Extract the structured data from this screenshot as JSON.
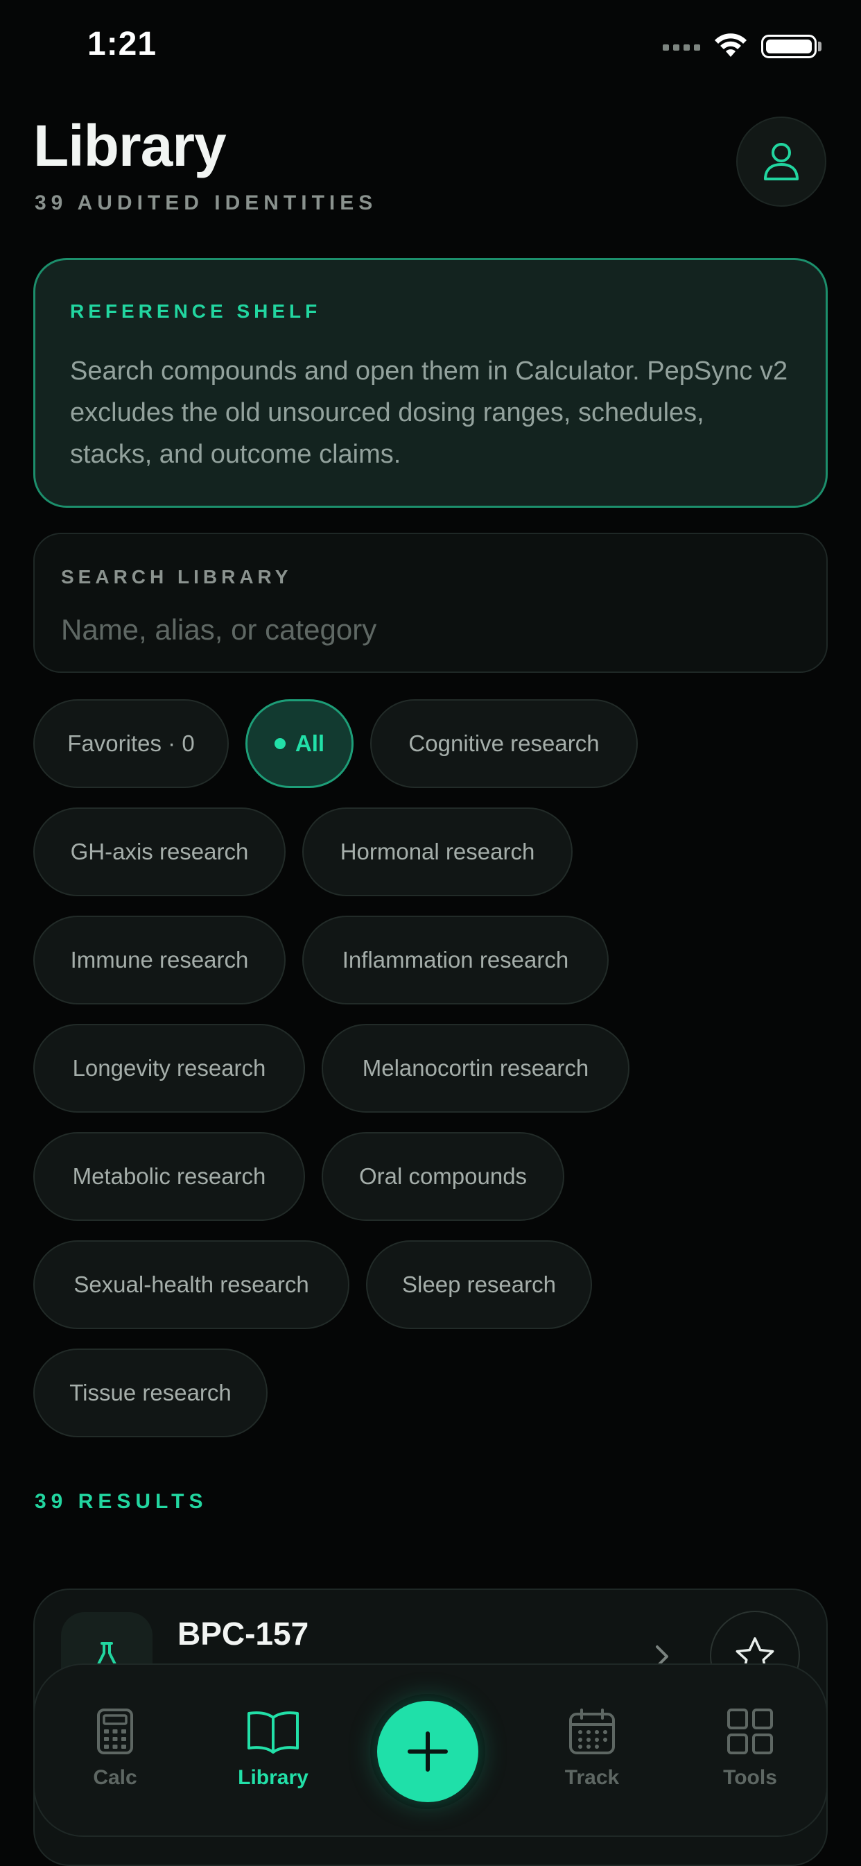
{
  "status_bar": {
    "time": "1:21"
  },
  "header": {
    "title": "Library",
    "subtitle": "39 AUDITED IDENTITIES",
    "profile_icon": "person-icon"
  },
  "reference_card": {
    "heading": "REFERENCE SHELF",
    "body": "Search compounds and open them in Calculator. PepSync v2 excludes the old unsourced dosing ranges, schedules, stacks, and outcome claims."
  },
  "search": {
    "label": "SEARCH LIBRARY",
    "value": "",
    "placeholder": "Name, alias, or category"
  },
  "filters": {
    "selected": "All",
    "chips": [
      "Favorites · 0",
      "All",
      "Cognitive research",
      "GH-axis research",
      "Hormonal research",
      "Immune research",
      "Inflammation research",
      "Longevity research",
      "Melanocortin research",
      "Metabolic research",
      "Oral compounds",
      "Sexual-health research",
      "Sleep research",
      "Tissue research"
    ]
  },
  "results": {
    "count_label": "39 RESULTS",
    "items": [
      {
        "name": "BPC-157",
        "icon": "flask-icon"
      }
    ]
  },
  "tabbar": {
    "tabs": [
      {
        "label": "Calc",
        "icon": "calculator-icon"
      },
      {
        "label": "Library",
        "icon": "book-icon"
      },
      {
        "label": "Track",
        "icon": "calendar-icon"
      },
      {
        "label": "Tools",
        "icon": "grid-icon"
      }
    ],
    "active": "Library",
    "fab_icon": "plus-icon"
  },
  "colors": {
    "background": "#050606",
    "accent": "#1fe0a9",
    "card": "#111615",
    "reference_card": "#13231f"
  }
}
